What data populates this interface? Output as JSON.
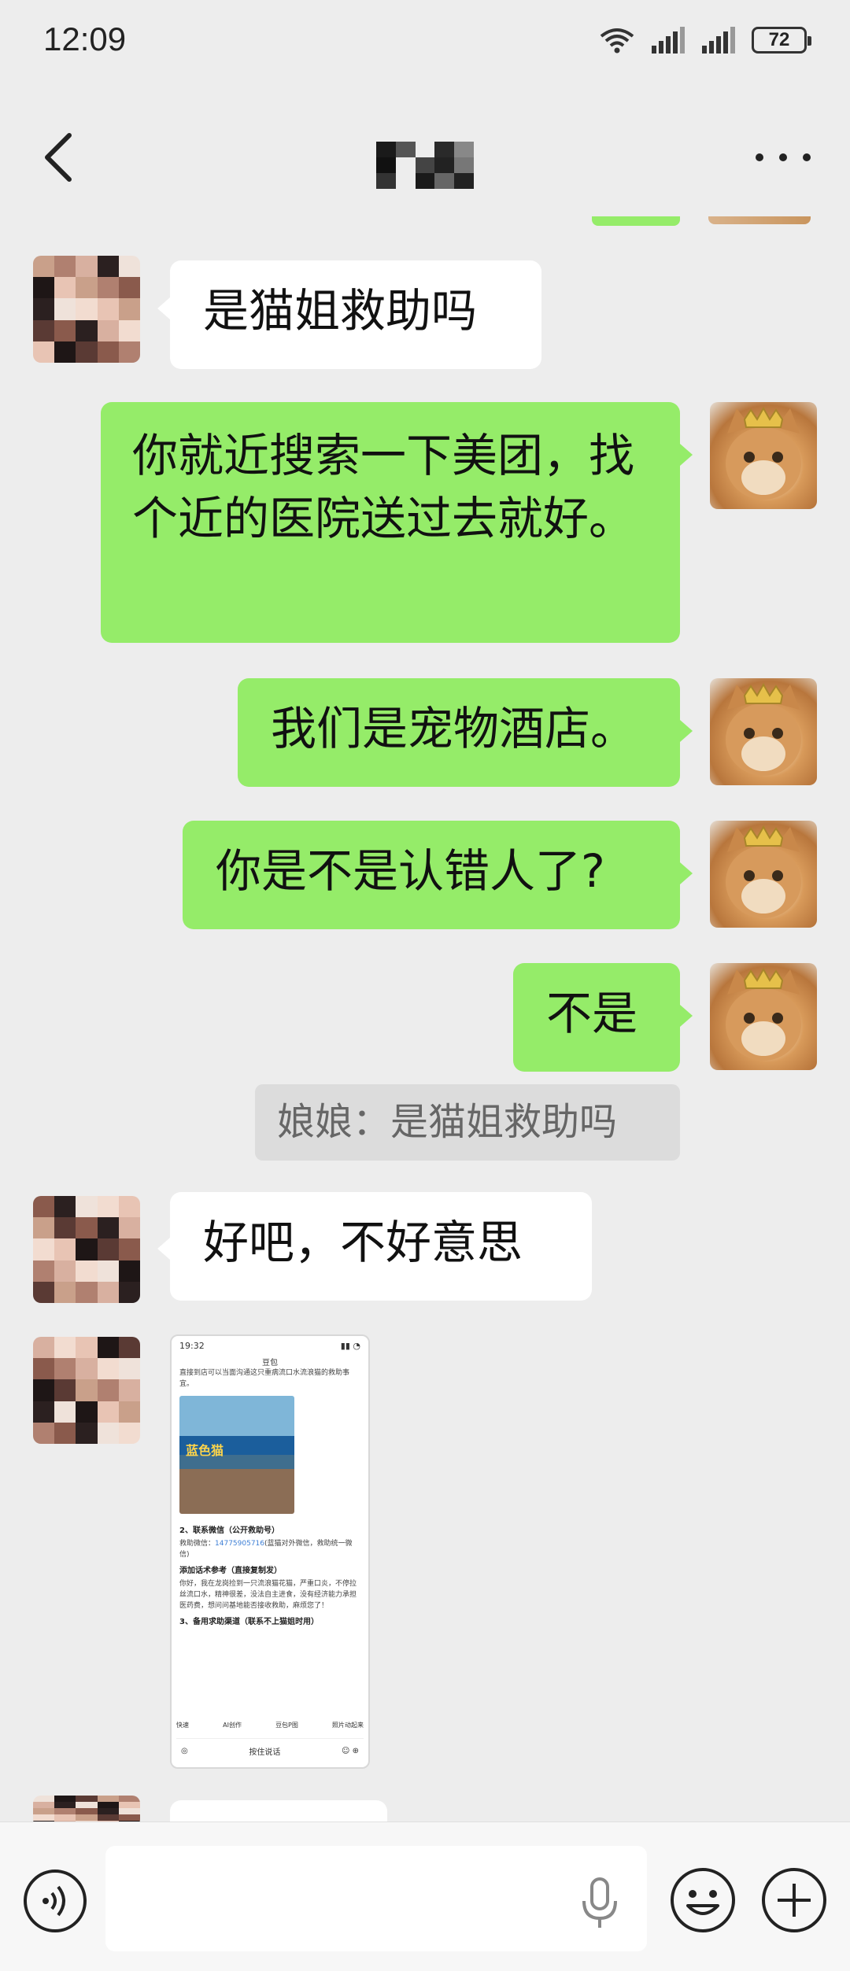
{
  "status_bar": {
    "time": "12:09",
    "battery": "72",
    "icons": [
      "wifi-icon",
      "signal-icon",
      "signal-icon",
      "battery-icon"
    ]
  },
  "nav": {
    "title_icon": "blurred-contact-name",
    "back_icon": "chevron-left-icon",
    "more_icon": "more-dots-icon"
  },
  "messages": [
    {
      "side": "left",
      "avatar": "blurred-avatar",
      "text": "是猫姐救助吗"
    },
    {
      "side": "right",
      "avatar": "cat-crown-avatar",
      "text": "你就近搜索一下美团，找个近的医院送过去就好。"
    },
    {
      "side": "right",
      "avatar": "cat-crown-avatar",
      "text": "我们是宠物酒店。"
    },
    {
      "side": "right",
      "avatar": "cat-crown-avatar",
      "text": "你是不是认错人了?"
    },
    {
      "side": "right",
      "avatar": "cat-crown-avatar",
      "text": "不是"
    },
    {
      "type": "quote",
      "text": "娘娘：是猫姐救助吗"
    },
    {
      "side": "left",
      "avatar": "blurred-avatar",
      "text": "好吧，不好意思"
    },
    {
      "side": "left",
      "avatar": "blurred-avatar",
      "type": "image"
    }
  ],
  "screenshot": {
    "time": "19:32",
    "title": "豆包",
    "line1": "直接到店可以当面沟通这只重病流口水流浪猫的救助事宜。",
    "section2": "2、联系微信（公开救助号）",
    "wechat_label": "救助微信：",
    "wechat_number": "14775905716",
    "wechat_note": "(蓝猫对外微信，救助统一微信)",
    "template_head": "添加话术参考（直接复制发）",
    "template_body": "你好，我在龙岗捡到一只流浪猫花猫，严重口炎，不停拉丝流口水，精神很差，没法自主进食，没有经济能力承担医药费，想问问基地能否接收救助，麻烦您了！",
    "section3": "3、备用求助渠道（联系不上猫姐时用）",
    "sign": "蓝色猫",
    "tabs": [
      "快速",
      "AI创作",
      "豆包P图",
      "照片动起来"
    ],
    "input_label": "按住说话"
  },
  "input_bar": {
    "placeholder": "",
    "icons": [
      "voice-icon",
      "mic-icon",
      "emoji-icon",
      "plus-icon"
    ]
  },
  "colors": {
    "green_bubble": "#95ec69",
    "white_bubble": "#ffffff",
    "background": "#ededed"
  }
}
